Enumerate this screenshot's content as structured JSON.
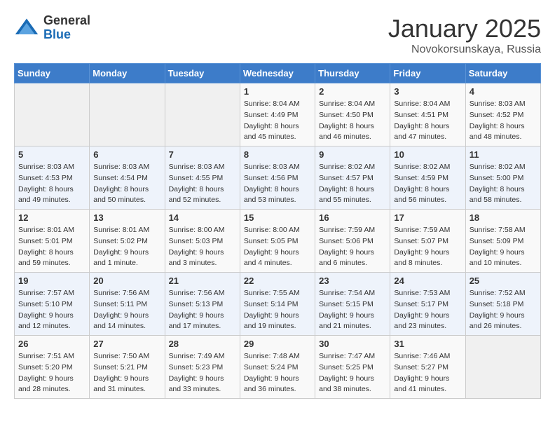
{
  "header": {
    "logo_general": "General",
    "logo_blue": "Blue",
    "month_title": "January 2025",
    "location": "Novokorsunskaya, Russia"
  },
  "weekdays": [
    "Sunday",
    "Monday",
    "Tuesday",
    "Wednesday",
    "Thursday",
    "Friday",
    "Saturday"
  ],
  "weeks": [
    [
      {
        "day": "",
        "sunrise": "",
        "sunset": "",
        "daylight": ""
      },
      {
        "day": "",
        "sunrise": "",
        "sunset": "",
        "daylight": ""
      },
      {
        "day": "",
        "sunrise": "",
        "sunset": "",
        "daylight": ""
      },
      {
        "day": "1",
        "sunrise": "Sunrise: 8:04 AM",
        "sunset": "Sunset: 4:49 PM",
        "daylight": "Daylight: 8 hours and 45 minutes."
      },
      {
        "day": "2",
        "sunrise": "Sunrise: 8:04 AM",
        "sunset": "Sunset: 4:50 PM",
        "daylight": "Daylight: 8 hours and 46 minutes."
      },
      {
        "day": "3",
        "sunrise": "Sunrise: 8:04 AM",
        "sunset": "Sunset: 4:51 PM",
        "daylight": "Daylight: 8 hours and 47 minutes."
      },
      {
        "day": "4",
        "sunrise": "Sunrise: 8:03 AM",
        "sunset": "Sunset: 4:52 PM",
        "daylight": "Daylight: 8 hours and 48 minutes."
      }
    ],
    [
      {
        "day": "5",
        "sunrise": "Sunrise: 8:03 AM",
        "sunset": "Sunset: 4:53 PM",
        "daylight": "Daylight: 8 hours and 49 minutes."
      },
      {
        "day": "6",
        "sunrise": "Sunrise: 8:03 AM",
        "sunset": "Sunset: 4:54 PM",
        "daylight": "Daylight: 8 hours and 50 minutes."
      },
      {
        "day": "7",
        "sunrise": "Sunrise: 8:03 AM",
        "sunset": "Sunset: 4:55 PM",
        "daylight": "Daylight: 8 hours and 52 minutes."
      },
      {
        "day": "8",
        "sunrise": "Sunrise: 8:03 AM",
        "sunset": "Sunset: 4:56 PM",
        "daylight": "Daylight: 8 hours and 53 minutes."
      },
      {
        "day": "9",
        "sunrise": "Sunrise: 8:02 AM",
        "sunset": "Sunset: 4:57 PM",
        "daylight": "Daylight: 8 hours and 55 minutes."
      },
      {
        "day": "10",
        "sunrise": "Sunrise: 8:02 AM",
        "sunset": "Sunset: 4:59 PM",
        "daylight": "Daylight: 8 hours and 56 minutes."
      },
      {
        "day": "11",
        "sunrise": "Sunrise: 8:02 AM",
        "sunset": "Sunset: 5:00 PM",
        "daylight": "Daylight: 8 hours and 58 minutes."
      }
    ],
    [
      {
        "day": "12",
        "sunrise": "Sunrise: 8:01 AM",
        "sunset": "Sunset: 5:01 PM",
        "daylight": "Daylight: 8 hours and 59 minutes."
      },
      {
        "day": "13",
        "sunrise": "Sunrise: 8:01 AM",
        "sunset": "Sunset: 5:02 PM",
        "daylight": "Daylight: 9 hours and 1 minute."
      },
      {
        "day": "14",
        "sunrise": "Sunrise: 8:00 AM",
        "sunset": "Sunset: 5:03 PM",
        "daylight": "Daylight: 9 hours and 3 minutes."
      },
      {
        "day": "15",
        "sunrise": "Sunrise: 8:00 AM",
        "sunset": "Sunset: 5:05 PM",
        "daylight": "Daylight: 9 hours and 4 minutes."
      },
      {
        "day": "16",
        "sunrise": "Sunrise: 7:59 AM",
        "sunset": "Sunset: 5:06 PM",
        "daylight": "Daylight: 9 hours and 6 minutes."
      },
      {
        "day": "17",
        "sunrise": "Sunrise: 7:59 AM",
        "sunset": "Sunset: 5:07 PM",
        "daylight": "Daylight: 9 hours and 8 minutes."
      },
      {
        "day": "18",
        "sunrise": "Sunrise: 7:58 AM",
        "sunset": "Sunset: 5:09 PM",
        "daylight": "Daylight: 9 hours and 10 minutes."
      }
    ],
    [
      {
        "day": "19",
        "sunrise": "Sunrise: 7:57 AM",
        "sunset": "Sunset: 5:10 PM",
        "daylight": "Daylight: 9 hours and 12 minutes."
      },
      {
        "day": "20",
        "sunrise": "Sunrise: 7:56 AM",
        "sunset": "Sunset: 5:11 PM",
        "daylight": "Daylight: 9 hours and 14 minutes."
      },
      {
        "day": "21",
        "sunrise": "Sunrise: 7:56 AM",
        "sunset": "Sunset: 5:13 PM",
        "daylight": "Daylight: 9 hours and 17 minutes."
      },
      {
        "day": "22",
        "sunrise": "Sunrise: 7:55 AM",
        "sunset": "Sunset: 5:14 PM",
        "daylight": "Daylight: 9 hours and 19 minutes."
      },
      {
        "day": "23",
        "sunrise": "Sunrise: 7:54 AM",
        "sunset": "Sunset: 5:15 PM",
        "daylight": "Daylight: 9 hours and 21 minutes."
      },
      {
        "day": "24",
        "sunrise": "Sunrise: 7:53 AM",
        "sunset": "Sunset: 5:17 PM",
        "daylight": "Daylight: 9 hours and 23 minutes."
      },
      {
        "day": "25",
        "sunrise": "Sunrise: 7:52 AM",
        "sunset": "Sunset: 5:18 PM",
        "daylight": "Daylight: 9 hours and 26 minutes."
      }
    ],
    [
      {
        "day": "26",
        "sunrise": "Sunrise: 7:51 AM",
        "sunset": "Sunset: 5:20 PM",
        "daylight": "Daylight: 9 hours and 28 minutes."
      },
      {
        "day": "27",
        "sunrise": "Sunrise: 7:50 AM",
        "sunset": "Sunset: 5:21 PM",
        "daylight": "Daylight: 9 hours and 31 minutes."
      },
      {
        "day": "28",
        "sunrise": "Sunrise: 7:49 AM",
        "sunset": "Sunset: 5:23 PM",
        "daylight": "Daylight: 9 hours and 33 minutes."
      },
      {
        "day": "29",
        "sunrise": "Sunrise: 7:48 AM",
        "sunset": "Sunset: 5:24 PM",
        "daylight": "Daylight: 9 hours and 36 minutes."
      },
      {
        "day": "30",
        "sunrise": "Sunrise: 7:47 AM",
        "sunset": "Sunset: 5:25 PM",
        "daylight": "Daylight: 9 hours and 38 minutes."
      },
      {
        "day": "31",
        "sunrise": "Sunrise: 7:46 AM",
        "sunset": "Sunset: 5:27 PM",
        "daylight": "Daylight: 9 hours and 41 minutes."
      },
      {
        "day": "",
        "sunrise": "",
        "sunset": "",
        "daylight": ""
      }
    ]
  ]
}
